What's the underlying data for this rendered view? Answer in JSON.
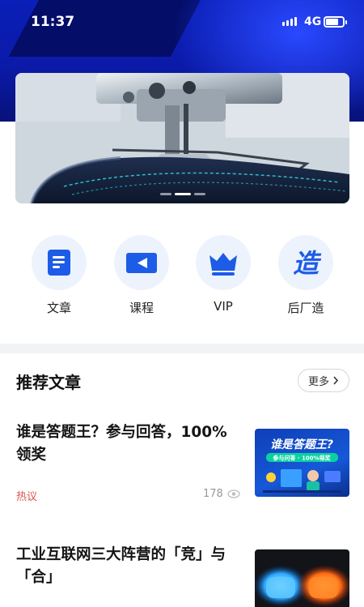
{
  "status": {
    "time": "11:37",
    "network": "4G"
  },
  "banner": {
    "slides": 3,
    "active_slide": 2
  },
  "quick_nav": [
    {
      "label": "文章",
      "icon": "article-icon"
    },
    {
      "label": "课程",
      "icon": "course-icon"
    },
    {
      "label": "VIP",
      "icon": "vip-crown-icon"
    },
    {
      "label": "后厂造",
      "icon": "zao-icon",
      "glyph": "造"
    }
  ],
  "section": {
    "title": "推荐文章",
    "more_label": "更多"
  },
  "articles": [
    {
      "title": "谁是答题王？参与回答，100%领奖",
      "tag": "热议",
      "views": "178",
      "thumb": {
        "headline": "谁是答题王?",
        "subline": "参与问答 · 100%得奖"
      }
    },
    {
      "title": "工业互联网三大阵营的「竞」与「合」"
    }
  ],
  "colors": {
    "brand_blue": "#0b1aa8",
    "tag_red": "#d9534f",
    "icon_blue": "#1d5ce6"
  }
}
